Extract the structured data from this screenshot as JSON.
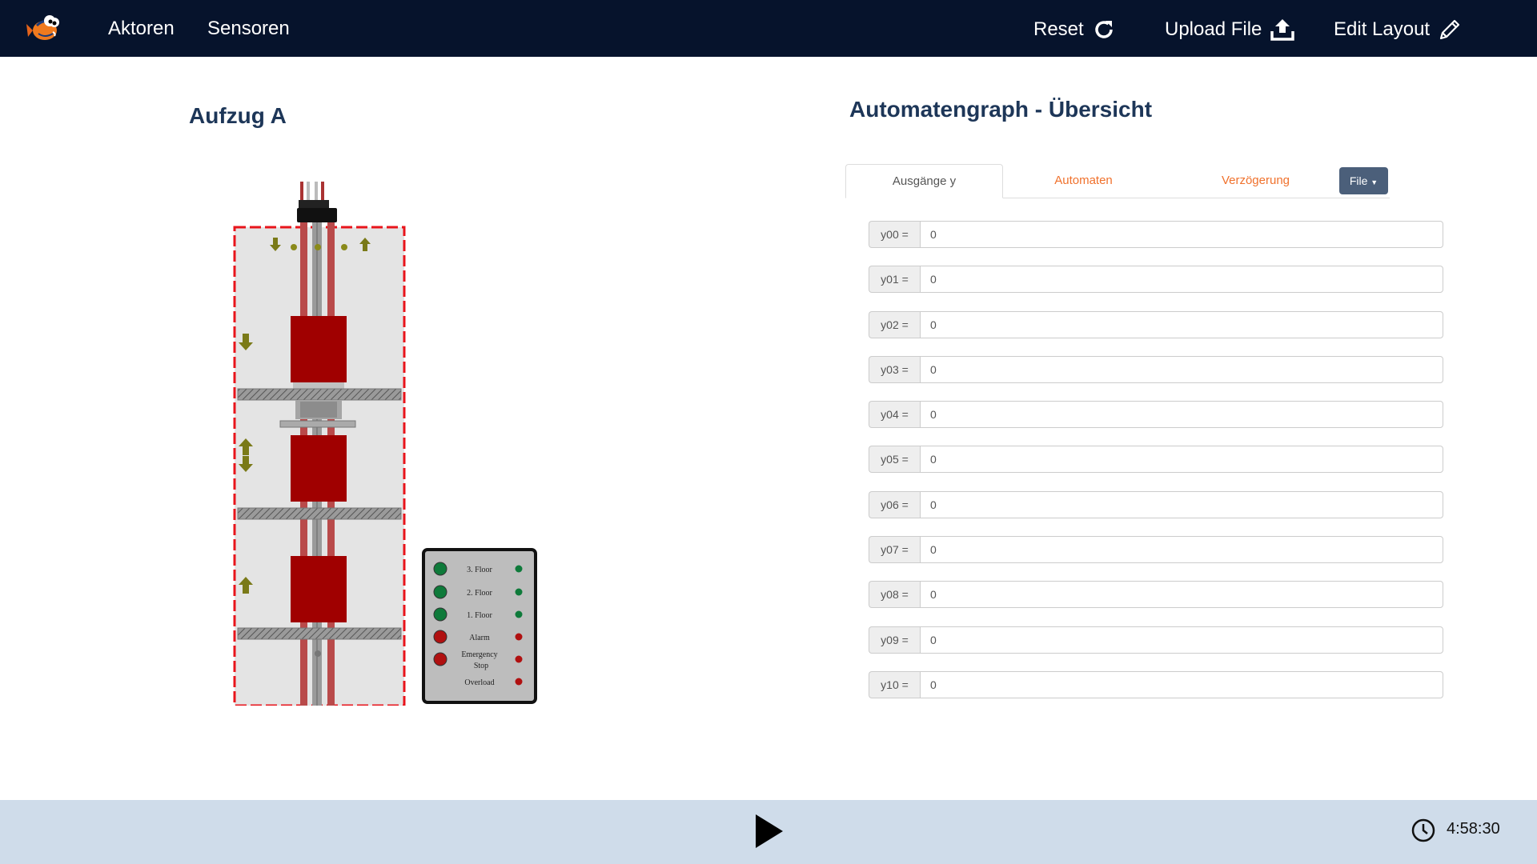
{
  "nav": {
    "aktoren": "Aktoren",
    "sensoren": "Sensoren",
    "reset": "Reset",
    "upload": "Upload File",
    "edit_layout": "Edit Layout"
  },
  "left": {
    "title": "Aufzug A",
    "panel": {
      "labels": [
        "3. Floor",
        "2. Floor",
        "1. Floor",
        "Alarm",
        "Emergency",
        "Stop",
        "Overload"
      ]
    }
  },
  "right": {
    "title": "Automatengraph - Übersicht",
    "tabs": [
      "Ausgänge y",
      "Automaten",
      "Verzögerung"
    ],
    "file_button": "File",
    "outputs": [
      {
        "label": "y00 =",
        "value": "0"
      },
      {
        "label": "y01 =",
        "value": "0"
      },
      {
        "label": "y02 =",
        "value": "0"
      },
      {
        "label": "y03 =",
        "value": "0"
      },
      {
        "label": "y04 =",
        "value": "0"
      },
      {
        "label": "y05 =",
        "value": "0"
      },
      {
        "label": "y06 =",
        "value": "0"
      },
      {
        "label": "y07 =",
        "value": "0"
      },
      {
        "label": "y08 =",
        "value": "0"
      },
      {
        "label": "y09 =",
        "value": "0"
      },
      {
        "label": "y10 =",
        "value": "0"
      }
    ]
  },
  "footer": {
    "time": "4:58:30"
  },
  "colors": {
    "topbar": "#06132c",
    "heading": "#1d3658",
    "tab_link": "#f0712c",
    "file_button": "#4b5f7a",
    "bottombar": "#cfdcea",
    "car_red": "#a00000",
    "shaft_border": "#e8141b"
  }
}
